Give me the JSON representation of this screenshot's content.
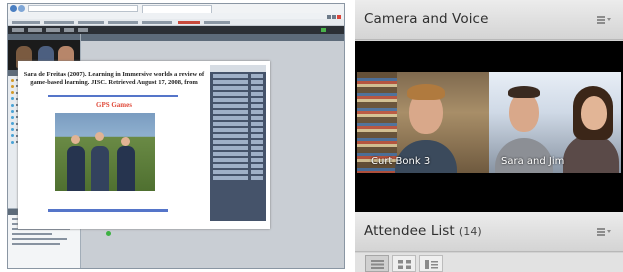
{
  "camera_pod": {
    "title": "Camera and Voice",
    "menu_icon": "pod-menu-icon",
    "feeds": [
      {
        "name": "Curt Bonk 3"
      },
      {
        "name": "Sara and Jim"
      }
    ]
  },
  "attendee_pod": {
    "title": "Attendee List",
    "count": "(14)",
    "menu_icon": "pod-menu-icon",
    "view_buttons": [
      "list-view-icon",
      "grid-view-icon",
      "sort-view-icon"
    ]
  },
  "shared_document": {
    "title": "Sara de Freitas (2007). Learning in Immersive worlds a review of game-based learning. JISC. Retrieved August 17, 2008, from",
    "subtitle": "GPS Games"
  },
  "colors": {
    "pod_title_bg": "#dcdcdc",
    "video_bg": "#000000",
    "accent_red": "#e04a3a",
    "connect_toolbar": "#2b2f35"
  }
}
